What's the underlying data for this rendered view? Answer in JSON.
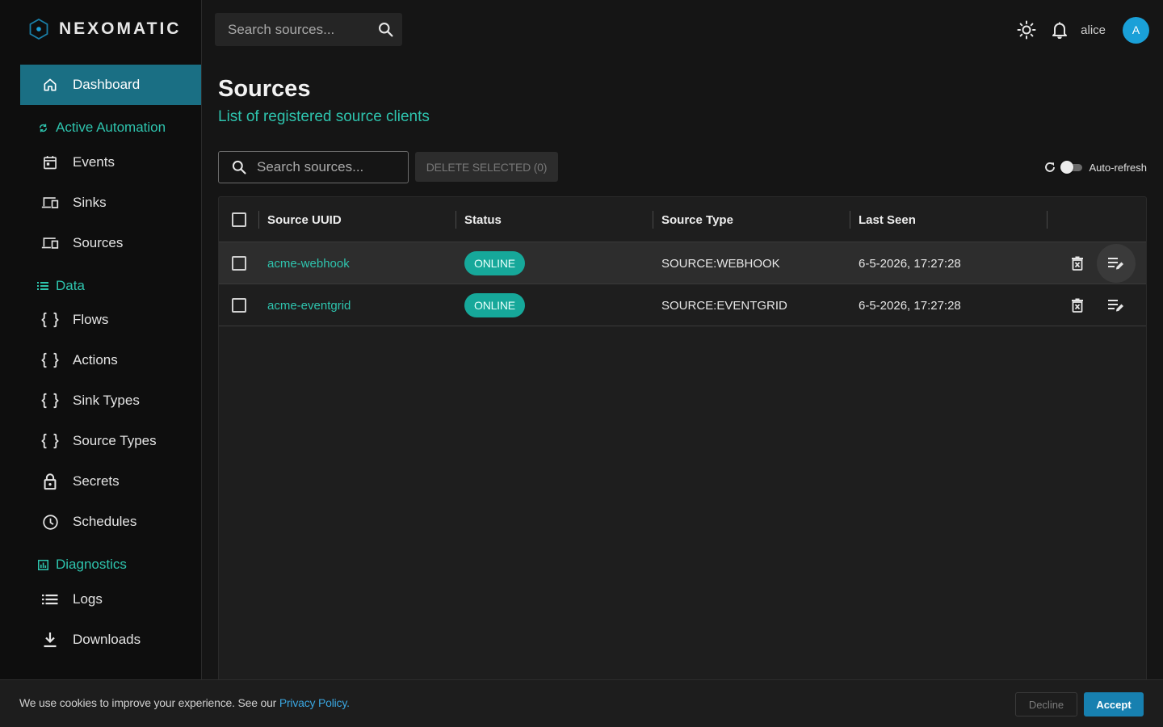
{
  "app": {
    "brand": "NEXOMATIC"
  },
  "sidebar": {
    "items": [
      {
        "label": "Dashboard",
        "icon": "home-icon",
        "active": true
      },
      {
        "label": "Events",
        "icon": "calendar-icon"
      },
      {
        "label": "Sinks",
        "icon": "devices-icon"
      },
      {
        "label": "Sources",
        "icon": "devices-icon"
      },
      {
        "label": "Flows",
        "icon": "braces-icon"
      },
      {
        "label": "Actions",
        "icon": "braces-icon"
      },
      {
        "label": "Sink Types",
        "icon": "braces-icon"
      },
      {
        "label": "Source Types",
        "icon": "braces-icon"
      },
      {
        "label": "Secrets",
        "icon": "lock-icon"
      },
      {
        "label": "Schedules",
        "icon": "clock-icon"
      },
      {
        "label": "Logs",
        "icon": "list-icon"
      },
      {
        "label": "Downloads",
        "icon": "download-icon"
      }
    ],
    "sections": [
      {
        "label": "Active Automation",
        "icon": "sync-icon"
      },
      {
        "label": "Data",
        "icon": "list-icon"
      },
      {
        "label": "Diagnostics",
        "icon": "chart-icon"
      }
    ]
  },
  "topbar": {
    "search_placeholder": "Search sources...",
    "username": "alice",
    "avatar_initial": "A"
  },
  "page": {
    "title": "Sources",
    "subtitle": "List of registered source clients"
  },
  "toolbar": {
    "search_placeholder": "Search sources...",
    "delete_label": "DELETE SELECTED (0)",
    "autorefresh_label": "Auto-refresh",
    "autorefresh_on": false
  },
  "table": {
    "columns": [
      "Source UUID",
      "Status",
      "Source Type",
      "Last Seen"
    ],
    "rows": [
      {
        "uuid": "acme-webhook",
        "status": "ONLINE",
        "type": "SOURCE:WEBHOOK",
        "last_seen": "6-5-2026, 17:27:28"
      },
      {
        "uuid": "acme-eventgrid",
        "status": "ONLINE",
        "type": "SOURCE:EVENTGRID",
        "last_seen": "6-5-2026, 17:27:28"
      }
    ]
  },
  "cookie": {
    "text": "We use cookies to improve your experience. See our ",
    "link": "Privacy Policy.",
    "decline": "Decline",
    "accept": "Accept"
  },
  "colors": {
    "accent": "#2ec4ae",
    "active_nav": "#1a6f84",
    "status_online": "#16a89a",
    "avatar": "#1aa0d8",
    "accept": "#1780b0"
  }
}
